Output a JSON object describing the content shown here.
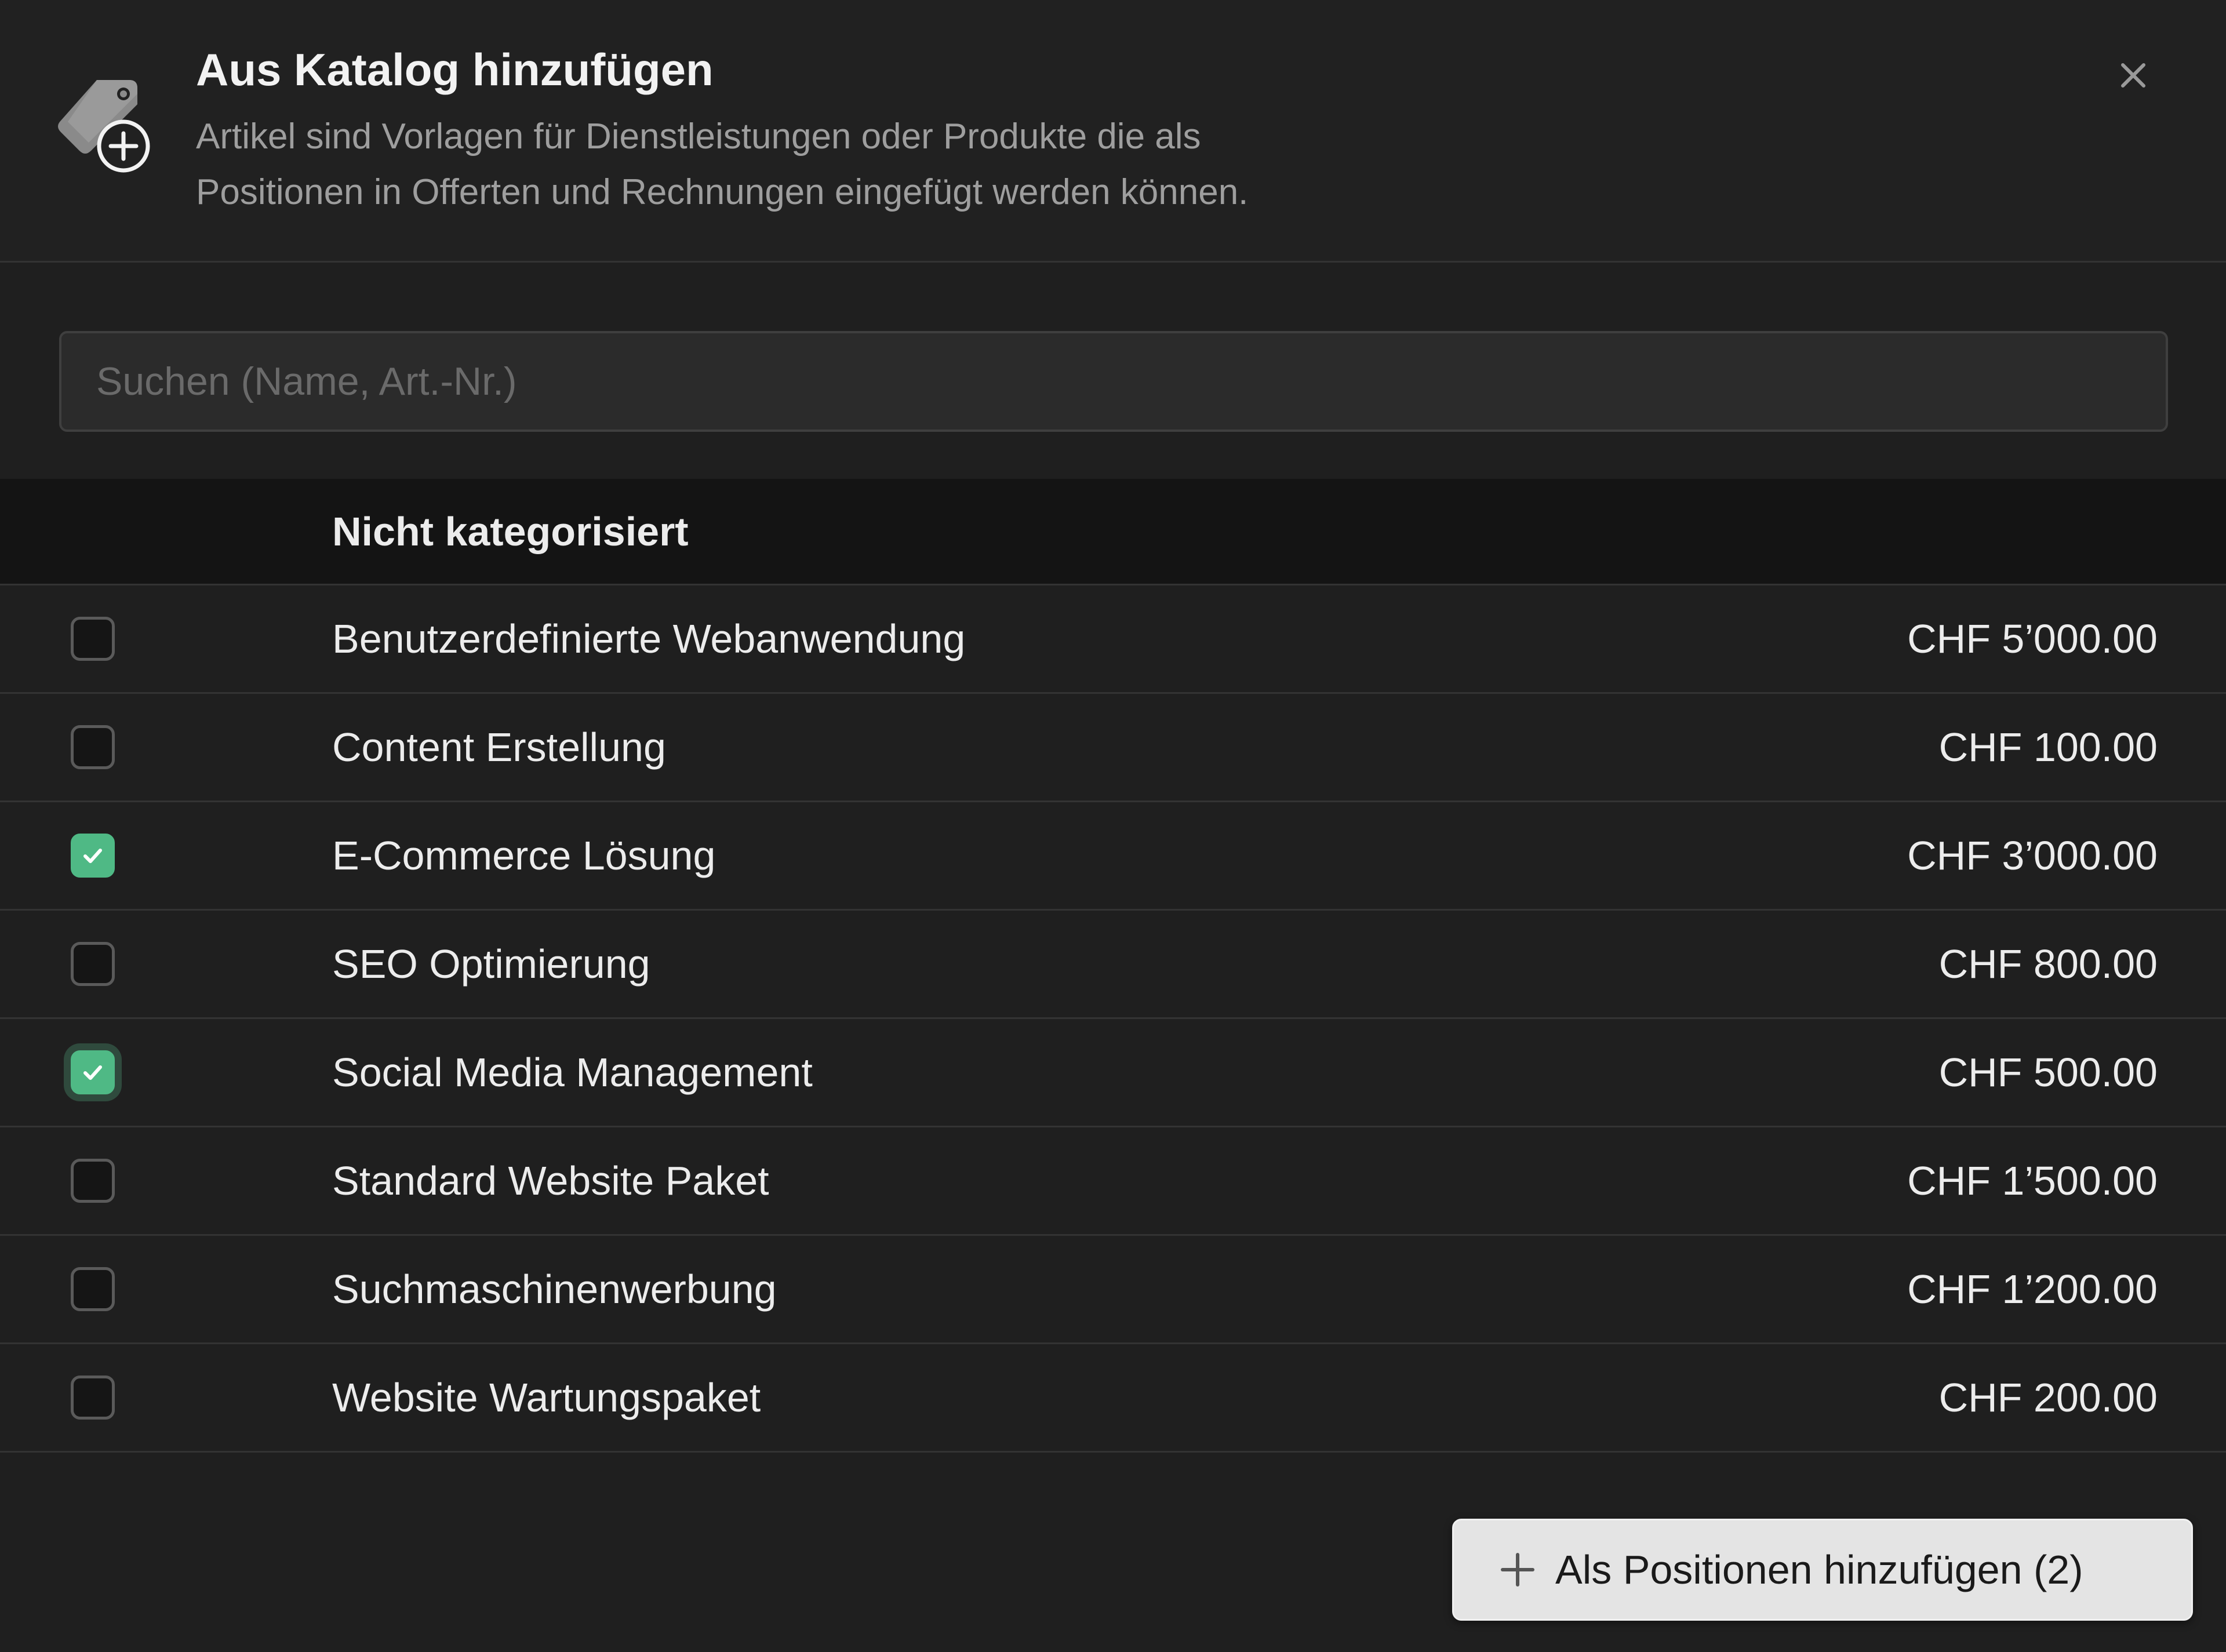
{
  "dialog": {
    "title": "Aus Katalog hinzufügen",
    "subtitle_line1": "Artikel sind Vorlagen für Dienstleistungen oder Produkte die als",
    "subtitle_line2": "Positionen in Offerten und Rechnungen eingefügt werden können.",
    "icon": "tag-add-icon",
    "close_icon": "close-icon"
  },
  "search": {
    "placeholder": "Suchen (Name, Art.-Nr.)",
    "value": ""
  },
  "group": {
    "label": "Nicht kategorisiert"
  },
  "items": [
    {
      "name": "Benutzerdefinierte Webanwendung",
      "price": "CHF 5’000.00",
      "checked": false
    },
    {
      "name": "Content Erstellung",
      "price": "CHF 100.00",
      "checked": false
    },
    {
      "name": "E-Commerce Lösung",
      "price": "CHF 3’000.00",
      "checked": true
    },
    {
      "name": "SEO Optimierung",
      "price": "CHF 800.00",
      "checked": false
    },
    {
      "name": "Social Media Management",
      "price": "CHF 500.00",
      "checked": true,
      "focused": true
    },
    {
      "name": "Standard Website Paket",
      "price": "CHF 1’500.00",
      "checked": false
    },
    {
      "name": "Suchmaschinenwerbung",
      "price": "CHF 1’200.00",
      "checked": false
    },
    {
      "name": "Website Wartungspaket",
      "price": "CHF 200.00",
      "checked": false
    }
  ],
  "footer": {
    "add_button_label": "Als Positionen hinzufügen (2)",
    "add_icon": "plus-icon"
  },
  "colors": {
    "background": "#1f1f1f",
    "accent_checked": "#4fb985",
    "button_bg": "#e4e4e4"
  }
}
